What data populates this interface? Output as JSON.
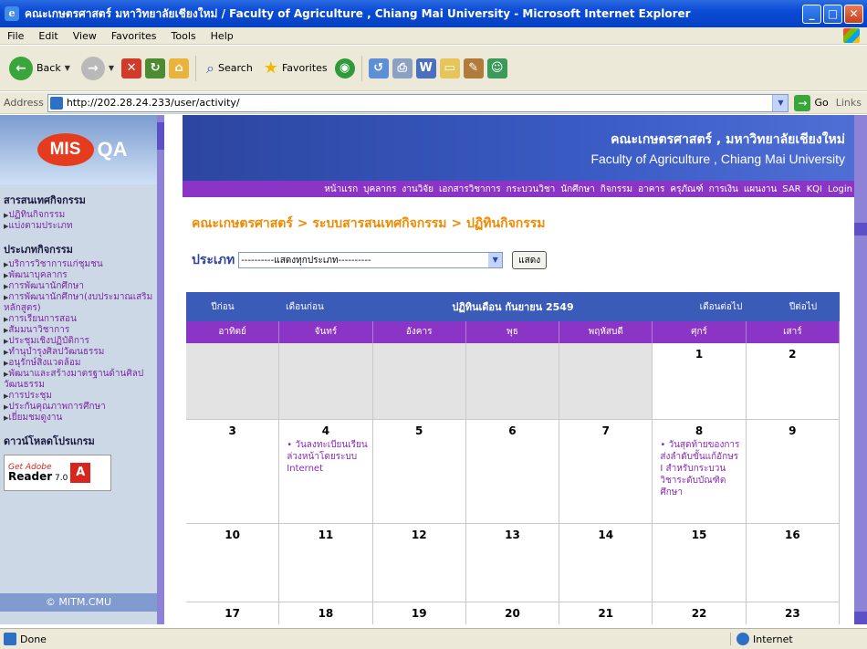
{
  "window": {
    "title": "คณะเกษตรศาสตร์ มหาวิทยาลัยเชียงใหม่ / Faculty of Agriculture , Chiang Mai University   - Microsoft Internet Explorer"
  },
  "menubar": {
    "items": [
      "File",
      "Edit",
      "View",
      "Favorites",
      "Tools",
      "Help"
    ]
  },
  "toolbar": {
    "back": "Back",
    "search": "Search",
    "favorites": "Favorites"
  },
  "addressbar": {
    "label": "Address",
    "url": "http://202.28.24.233/user/activity/",
    "go": "Go",
    "links": "Links"
  },
  "sidebar": {
    "logo": {
      "mis": "MIS",
      "qa": "QA"
    },
    "section1": {
      "title": "สารสนเทศกิจกรรม",
      "items": [
        "ปฏิทินกิจกรรม",
        "แบ่งตามประเภท"
      ]
    },
    "section2": {
      "title": "ประเภทกิจกรรม",
      "items": [
        "บริการวิชาการแก่ชุมชน",
        "พัฒนาบุคลากร",
        "การพัฒนานักศึกษา",
        "การพัฒนานักศึกษา(งบประมาณเสริมหลักสูตร)",
        "การเรียนการสอน",
        "สัมมนาวิชาการ",
        "ประชุมเชิงปฏิบัติการ",
        "ทำนุบำรุงศิลปวัฒนธรรม",
        "อนุรักษ์สิ่งแวดล้อม",
        "พัฒนาและสร้างมาตรฐานด้านศิลปวัฒนธรรม",
        "การประชุม",
        "ประกันคุณภาพการศึกษา",
        "เยี่ยมชมดูงาน"
      ]
    },
    "section3": {
      "title": "ดาวน์โหลดโปรแกรม"
    },
    "adobe": {
      "get": "Get Adobe",
      "reader": "Reader",
      "version": "7.0"
    },
    "copyright": "© MITM.CMU"
  },
  "banner": {
    "thai": "คณะเกษตรศาสตร์ , มหาวิทยาลัยเชียงใหม่",
    "english": "Faculty of Agriculture , Chiang Mai University"
  },
  "nav": [
    "หน้าแรก",
    "บุคลากร",
    "งานวิจัย",
    "เอกสารวิชาการ",
    "กระบวนวิชา",
    "นักศึกษา",
    "กิจกรรม",
    "อาคาร",
    "ครุภัณฑ์",
    "การเงิน",
    "แผนงาน",
    "SAR",
    "KQI",
    "Login"
  ],
  "breadcrumb": "คณะเกษตรศาสตร์ > ระบบสารสนเทศกิจกรรม > ปฏิทินกิจกรรม",
  "filter": {
    "label": "ประเภท",
    "selected": "----------แสดงทุกประเภท----------",
    "button": "แสดง"
  },
  "calendar": {
    "prev_year": "ปีก่อน",
    "prev_month": "เดือนก่อน",
    "title": "ปฏิทินเดือน กันยายน 2549",
    "next_month": "เดือนต่อไป",
    "next_year": "ปีต่อไป",
    "weekdays": [
      "อาทิตย์",
      "จันทร์",
      "อังคาร",
      "พุธ",
      "พฤหัสบดี",
      "ศุกร์",
      "เสาร์"
    ],
    "weeks": [
      [
        {
          "day": ""
        },
        {
          "day": ""
        },
        {
          "day": ""
        },
        {
          "day": ""
        },
        {
          "day": ""
        },
        {
          "day": "1"
        },
        {
          "day": "2"
        }
      ],
      [
        {
          "day": "3"
        },
        {
          "day": "4",
          "event": "• วันลงทะเบียนเรียนล่วงหน้าโดยระบบ Internet"
        },
        {
          "day": "5"
        },
        {
          "day": "6"
        },
        {
          "day": "7"
        },
        {
          "day": "8",
          "event": "• วันสุดท้ายของการส่งลำดับขั้นแก้อักษร I สำหรับกระบวนวิชาระดับบัณฑิตศึกษา"
        },
        {
          "day": "9"
        }
      ],
      [
        {
          "day": "10"
        },
        {
          "day": "11"
        },
        {
          "day": "12"
        },
        {
          "day": "13"
        },
        {
          "day": "14"
        },
        {
          "day": "15"
        },
        {
          "day": "16"
        }
      ],
      [
        {
          "day": "17"
        },
        {
          "day": "18"
        },
        {
          "day": "19"
        },
        {
          "day": "20"
        },
        {
          "day": "21"
        },
        {
          "day": "22"
        },
        {
          "day": "23"
        }
      ]
    ]
  },
  "status": {
    "left": "Done",
    "zone": "Internet"
  }
}
